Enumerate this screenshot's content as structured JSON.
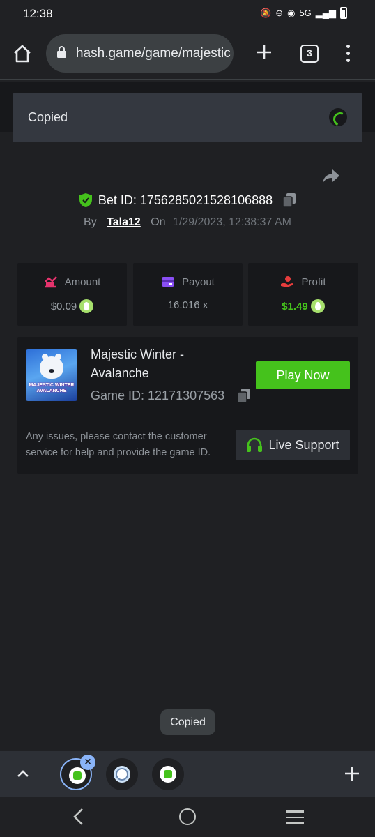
{
  "status_bar": {
    "time": "12:38",
    "network": "5G"
  },
  "browser": {
    "url": "hash.game/game/majestic",
    "tab_count": "3"
  },
  "toast": {
    "text": "Copied"
  },
  "bet": {
    "bet_id_label": "Bet ID: 1756285021528106888",
    "by_label": "By",
    "username": "Tala12",
    "on_label": "On",
    "date": "1/29/2023, 12:38:37 AM"
  },
  "stats": [
    {
      "title": "Amount",
      "value": "$0.09",
      "icon": "amount-icon",
      "color": "#e6336d"
    },
    {
      "title": "Payout",
      "value": "16.016 x",
      "icon": "wallet-icon",
      "color": "#8a4ff5"
    },
    {
      "title": "Profit",
      "value": "$1.49",
      "icon": "profit-icon",
      "color": "#e63c3c"
    }
  ],
  "game": {
    "title": "Majestic Winter - Avalanche",
    "thumbnail_text": "MAJESTIC WINTER AVALANCHE",
    "game_id_label": "Game ID: 12171307563",
    "play_button": "Play Now",
    "help_text": "Any issues, please contact the customer service for help and provide the game ID.",
    "support_button": "Live Support"
  },
  "snackbar": {
    "text": "Copied"
  },
  "colors": {
    "accent_green": "#45c21c",
    "background": "#1f2023",
    "card": "#17181b"
  }
}
